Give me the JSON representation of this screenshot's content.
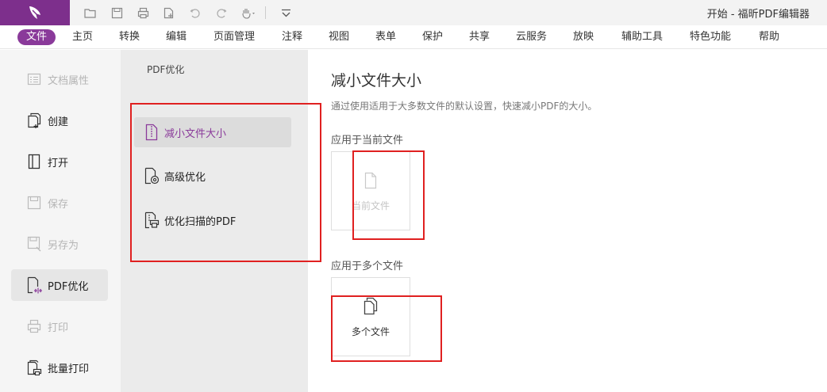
{
  "window": {
    "title": "开始 - 福昕PDF编辑器"
  },
  "quick_access": [
    "open-folder-icon",
    "save-icon",
    "print-icon",
    "new-document-icon",
    "undo-icon",
    "redo-icon",
    "hand-tool-icon",
    "customize-dropdown-icon"
  ],
  "menu": {
    "items": [
      "文件",
      "主页",
      "转换",
      "编辑",
      "页面管理",
      "注释",
      "视图",
      "表单",
      "保护",
      "共享",
      "云服务",
      "放映",
      "辅助工具",
      "特色功能",
      "帮助"
    ],
    "active": "文件"
  },
  "leftnav": {
    "items": [
      {
        "label": "文档属性",
        "icon": "document-properties-icon",
        "state": "disabled"
      },
      {
        "label": "创建",
        "icon": "create-icon",
        "state": "enabled"
      },
      {
        "label": "打开",
        "icon": "open-book-icon",
        "state": "enabled"
      },
      {
        "label": "保存",
        "icon": "save-icon",
        "state": "disabled"
      },
      {
        "label": "另存为",
        "icon": "save-as-icon",
        "state": "disabled"
      },
      {
        "label": "PDF优化",
        "icon": "pdf-optimize-icon",
        "state": "active"
      },
      {
        "label": "打印",
        "icon": "printer-icon",
        "state": "disabled"
      },
      {
        "label": "批量打印",
        "icon": "batch-print-icon",
        "state": "enabled"
      }
    ]
  },
  "subpanel": {
    "title": "PDF优化",
    "items": [
      {
        "label": "减小文件大小",
        "icon": "zip-file-icon",
        "active": true
      },
      {
        "label": "高级优化",
        "icon": "advanced-optimize-icon",
        "active": false
      },
      {
        "label": "优化扫描的PDF",
        "icon": "scanned-pdf-icon",
        "active": false
      }
    ]
  },
  "main": {
    "title": "减小文件大小",
    "description": "通过使用适用于大多数文件的默认设置，快速减小PDF的大小。",
    "current_section": {
      "label": "应用于当前文件",
      "card_label": "当前文件",
      "card_icon": "document-icon",
      "state": "disabled"
    },
    "multi_section": {
      "label": "应用于多个文件",
      "card_label": "多个文件",
      "card_icon": "multiple-documents-icon",
      "state": "enabled"
    }
  },
  "colors": {
    "brand": "#7d2f8c",
    "active_menu": "#8a3a9a",
    "highlight_box": "#e02020"
  }
}
